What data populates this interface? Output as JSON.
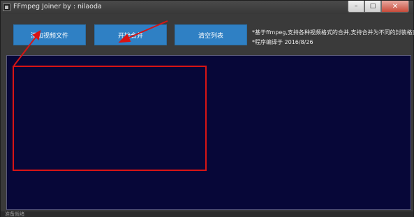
{
  "window": {
    "title": "FFmpeg Joiner  by : nilaoda",
    "controls": {
      "minimize": "–",
      "maximize": "□",
      "close": "✕"
    }
  },
  "toolbar": {
    "add_video_label": "添加视频文件",
    "start_merge_label": "开始合并",
    "clear_list_label": "清空列表"
  },
  "info": {
    "line1": "*基于ffmpeg,支持各种视频格式的合并,支持合并为不同的封装格式",
    "line2": "*程序编译于 2016/8/26"
  },
  "file_list": {
    "items": []
  },
  "status": {
    "text": "准备就绪"
  },
  "colors": {
    "window_bg": "#3a3a3a",
    "button_bg": "#2f80c4",
    "list_bg": "#070738",
    "annotation": "#d81414"
  },
  "icons": {
    "app": "ffmpeg-app-icon",
    "minimize": "minimize-icon",
    "maximize": "maximize-icon",
    "close": "close-icon"
  }
}
